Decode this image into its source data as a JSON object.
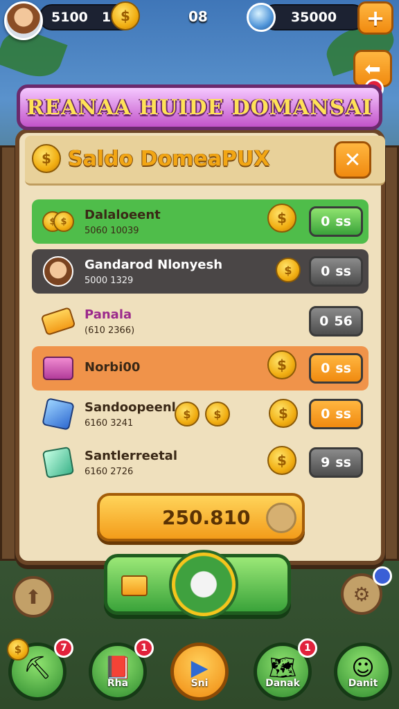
{
  "topbar": {
    "coins_value": "5100",
    "coins_count": "1",
    "center_value": "08",
    "gems_value": "35000",
    "plus_icon": "plus-icon"
  },
  "title": "REANAA HUIDE DOMANSAI",
  "subhead": {
    "title": "Saldo DomeaPUX",
    "close_icon": "close-icon"
  },
  "rows": [
    {
      "label": "Dalaloeent",
      "sub": "5060 10039",
      "value": "0",
      "suffix": "ss",
      "style": "green",
      "icon": "coin-stack-icon"
    },
    {
      "label": "Gandarod Nlonyesh",
      "sub": "5000 1329",
      "value": "0",
      "suffix": "ss",
      "style": "dark",
      "icon": "character-portrait-icon"
    },
    {
      "label": "Panala",
      "sub": "(610 2366)",
      "value": "0",
      "suffix": "56",
      "style": "plain",
      "icon": "ticket-icon"
    },
    {
      "label": "Norbi00",
      "sub": "",
      "value": "0",
      "suffix": "ss",
      "style": "orange",
      "icon": "chest-icon"
    },
    {
      "label": "Sandoopeenl",
      "sub": "6160 3241",
      "value": "0",
      "suffix": "ss",
      "style": "plain",
      "icon": "blue-crystal-icon"
    },
    {
      "label": "Santlerreetal",
      "sub": "6160 2726",
      "value": "9",
      "suffix": "ss",
      "style": "plain",
      "icon": "green-crystal-icon"
    }
  ],
  "total": "250.810",
  "nav": [
    {
      "label": "",
      "badge": "7",
      "icon": "hammer-icon"
    },
    {
      "label": "Rha",
      "badge": "1",
      "icon": "book-icon"
    },
    {
      "label": "Sni",
      "badge": "",
      "icon": "play-icon"
    },
    {
      "label": "Danak",
      "badge": "1",
      "icon": "map-icon"
    },
    {
      "label": "Danit",
      "badge": "",
      "icon": "character-icon"
    }
  ],
  "colors": {
    "accent": "#f08a10",
    "title_bg": "#c254c9",
    "panel_bg": "#efe0bd",
    "green": "#3aa33a"
  }
}
